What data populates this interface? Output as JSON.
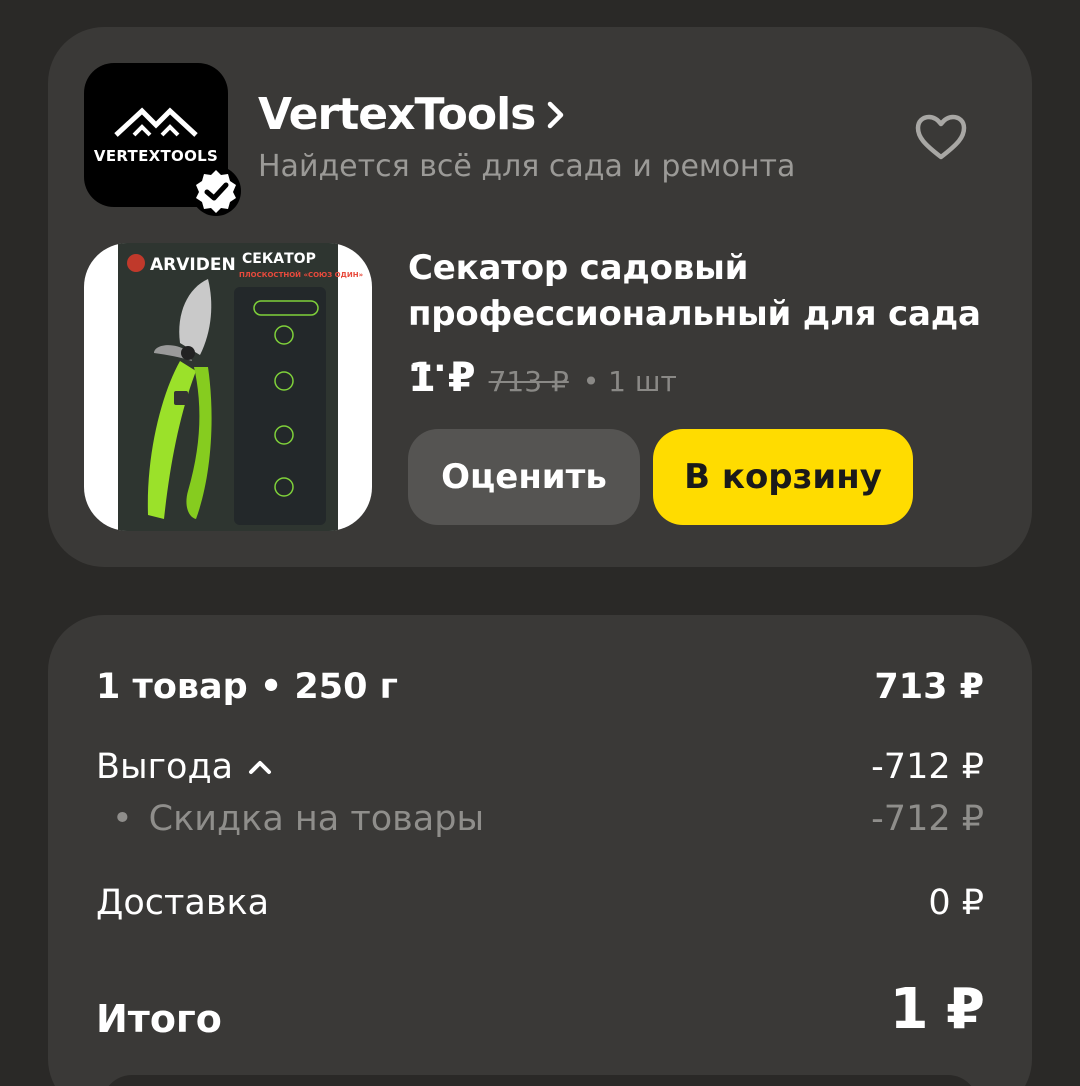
{
  "shop": {
    "logo_text": "VERTEXTOOLS",
    "name": "VertexTools",
    "tagline": "Найдется всё для сада и ремонта",
    "icons": {
      "verified": "verified-badge-icon",
      "chevron": "chevron-right-icon",
      "favorite": "heart-outline-icon"
    }
  },
  "product": {
    "image_brand": "ARVIDEN",
    "image_title": "СЕКАТОР",
    "image_subtitle": "ПЛОСКОСТНОЙ «СОЮЗ ОДИН»",
    "title": "Секатор садовый профессиональный для сада ...",
    "price_current": "1 ₽",
    "price_old": "713 ₽",
    "quantity": "• 1 шт",
    "rate_button": "Оценить",
    "cart_button": "В корзину"
  },
  "summary": {
    "items_label": "1 товар • 250 г",
    "items_value": "713 ₽",
    "benefit_label": "Выгода",
    "benefit_value": "-712 ₽",
    "discount_bullet": "•",
    "discount_label": "Скидка на товары",
    "discount_value": "-712 ₽",
    "delivery_label": "Доставка",
    "delivery_value": "0 ₽",
    "total_label": "Итого",
    "total_value": "1 ₽"
  },
  "colors": {
    "background": "#2a2927",
    "card": "#3a3937",
    "accent_yellow": "#ffdc00",
    "secondary_button": "#555452",
    "muted_text": "#9b9a97"
  }
}
